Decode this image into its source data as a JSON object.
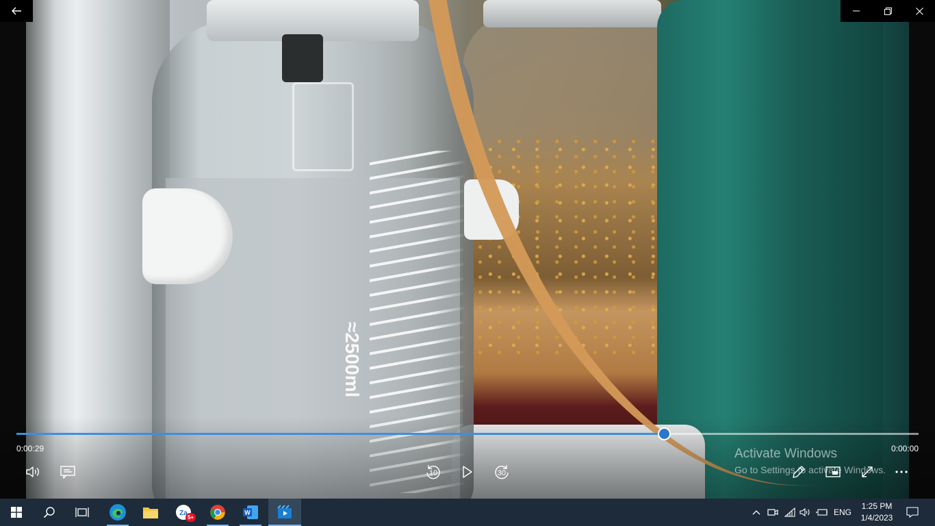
{
  "window": {
    "back_icon": "back-arrow-icon",
    "minimize_icon": "minimize-icon",
    "restore_icon": "restore-icon",
    "close_icon": "close-icon"
  },
  "video": {
    "frame_text": "≈2500ml"
  },
  "player": {
    "elapsed": "0:00:29",
    "remaining": "0:00:00",
    "progress_fraction": 0.718,
    "skip_back_seconds": "10",
    "skip_forward_seconds": "30",
    "accent_color": "#3d8fe0"
  },
  "watermark": {
    "title": "Activate Windows",
    "subtitle": "Go to Settings to activate Windows."
  },
  "taskbar": {
    "chat_badge": "5+",
    "language": "ENG",
    "time": "1:25 PM",
    "date": "1/4/2023",
    "background_color": "#1d2b3a"
  }
}
